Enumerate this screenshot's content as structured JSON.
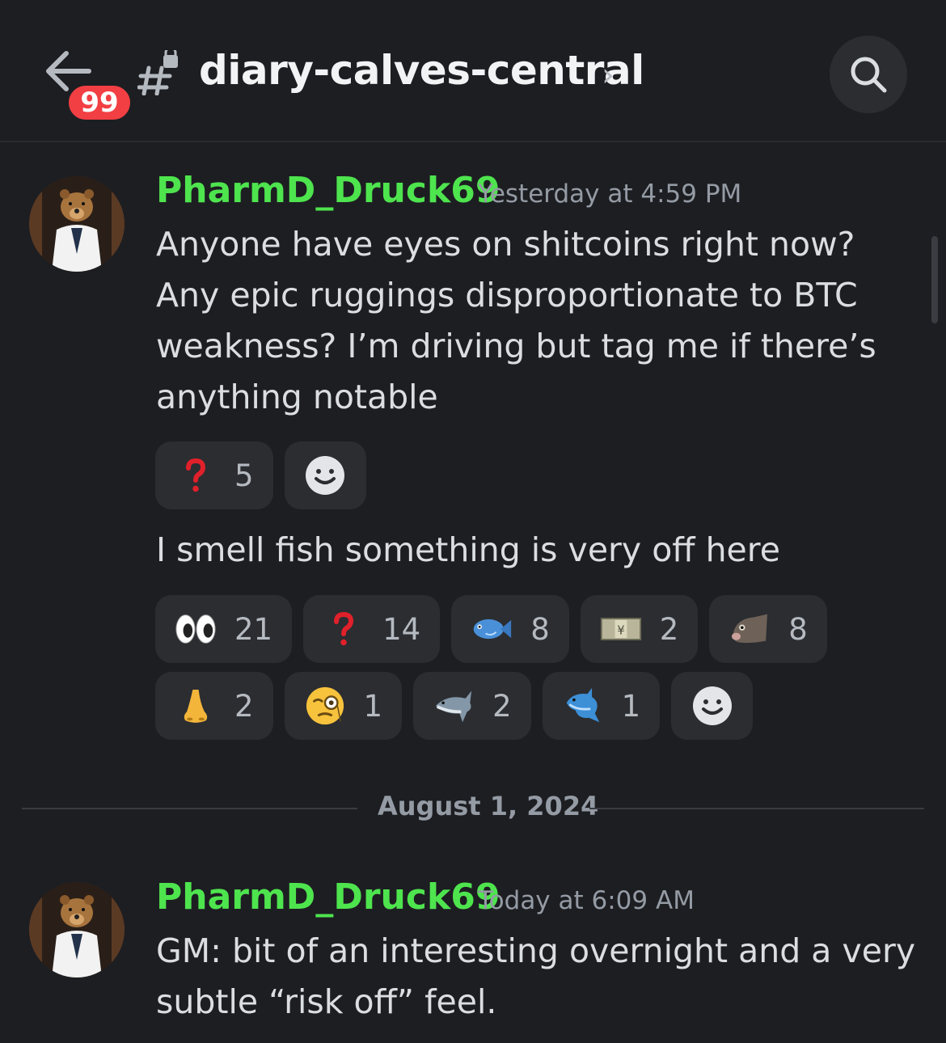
{
  "header": {
    "unread_badge": "99",
    "channel_name": "diary-calves-central",
    "chevron": "›"
  },
  "messages": [
    {
      "username": "PharmD_Druck69",
      "timestamp": "Yesterday at 4:59 PM",
      "text": "Anyone have eyes on shitcoins right now? Any epic ruggings disproportionate to BTC weakness? I’m driving but tag me if there’s anything notable",
      "reactions": [
        {
          "emoji": "question-mark-icon",
          "count": "5"
        }
      ],
      "followup_text": "I smell fish something is very off here",
      "followup_reactions_row1": [
        {
          "emoji": "eyes-icon",
          "count": "21"
        },
        {
          "emoji": "question-mark-icon",
          "count": "14"
        },
        {
          "emoji": "fish-icon",
          "count": "8"
        },
        {
          "emoji": "money-icon",
          "count": "2"
        },
        {
          "emoji": "fish-face-icon",
          "count": "8"
        }
      ],
      "followup_reactions_row2": [
        {
          "emoji": "nose-icon",
          "count": "2"
        },
        {
          "emoji": "monocle-face-icon",
          "count": "1"
        },
        {
          "emoji": "shark-icon",
          "count": "2"
        },
        {
          "emoji": "dolphin-icon",
          "count": "1"
        }
      ]
    },
    {
      "username": "PharmD_Druck69",
      "timestamp": "Today at 6:09 AM",
      "text": "GM: bit  of an interesting overnight and a very subtle “risk off” feel."
    }
  ],
  "divider": {
    "date": "August 1, 2024"
  },
  "colors": {
    "background": "#1d1e22",
    "username": "#4ee44e",
    "reaction_bg": "#2b2d31",
    "badge": "#f23f43"
  }
}
